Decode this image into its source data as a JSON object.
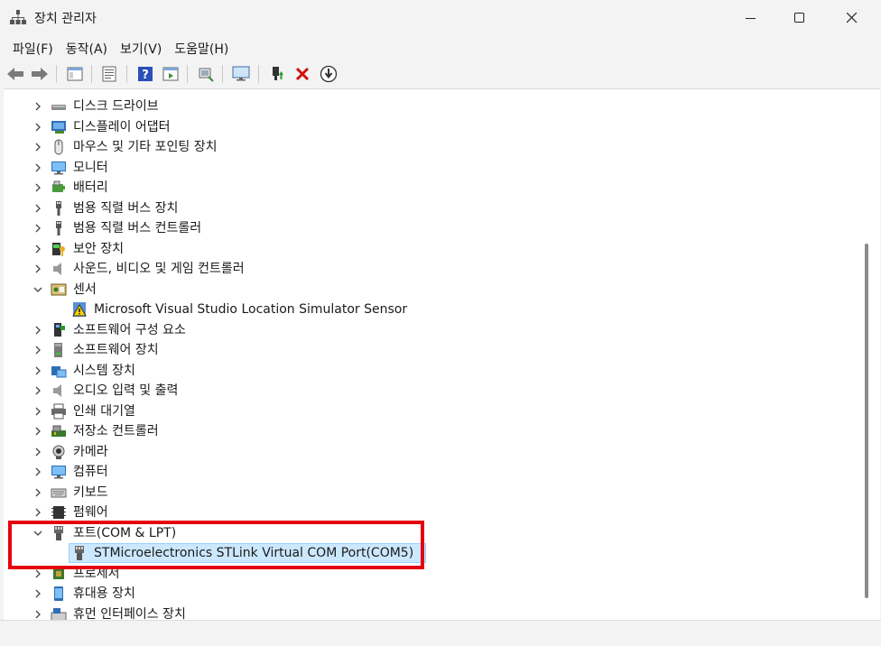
{
  "window": {
    "title": "장치 관리자"
  },
  "menu": [
    "파일(F)",
    "동작(A)",
    "보기(V)",
    "도움말(H)"
  ],
  "tree": [
    {
      "label": "디스크 드라이브",
      "icon": "disk-drive-icon",
      "expanded": false
    },
    {
      "label": "디스플레이 어댑터",
      "icon": "display-adapter-icon",
      "expanded": false
    },
    {
      "label": "마우스 및 기타 포인팅 장치",
      "icon": "mouse-icon",
      "expanded": false
    },
    {
      "label": "모니터",
      "icon": "monitor-icon",
      "expanded": false
    },
    {
      "label": "배터리",
      "icon": "battery-icon",
      "expanded": false
    },
    {
      "label": "범용 직렬 버스 장치",
      "icon": "usb-device-icon",
      "expanded": false
    },
    {
      "label": "범용 직렬 버스 컨트롤러",
      "icon": "usb-controller-icon",
      "expanded": false
    },
    {
      "label": "보안 장치",
      "icon": "security-device-icon",
      "expanded": false
    },
    {
      "label": "사운드, 비디오 및 게임 컨트롤러",
      "icon": "speaker-icon",
      "expanded": false
    },
    {
      "label": "센서",
      "icon": "sensor-icon",
      "expanded": true
    },
    {
      "label": "Microsoft Visual Studio Location Simulator Sensor",
      "icon": "warning-sensor-icon",
      "child": true
    },
    {
      "label": "소프트웨어 구성 요소",
      "icon": "software-component-icon",
      "expanded": false
    },
    {
      "label": "소프트웨어 장치",
      "icon": "software-device-icon",
      "expanded": false
    },
    {
      "label": "시스템 장치",
      "icon": "system-device-icon",
      "expanded": false
    },
    {
      "label": "오디오 입력 및 출력",
      "icon": "audio-icon",
      "expanded": false
    },
    {
      "label": "인쇄 대기열",
      "icon": "printer-icon",
      "expanded": false
    },
    {
      "label": "저장소 컨트롤러",
      "icon": "storage-controller-icon",
      "expanded": false
    },
    {
      "label": "카메라",
      "icon": "camera-icon",
      "expanded": false
    },
    {
      "label": "컴퓨터",
      "icon": "computer-icon",
      "expanded": false
    },
    {
      "label": "키보드",
      "icon": "keyboard-icon",
      "expanded": false
    },
    {
      "label": "펌웨어",
      "icon": "firmware-icon",
      "expanded": false
    },
    {
      "label": "포트(COM & LPT)",
      "icon": "port-icon",
      "expanded": true
    },
    {
      "label": "STMicroelectronics STLink Virtual COM Port(COM5)",
      "icon": "port-icon",
      "child": true,
      "selected": true
    },
    {
      "label": "프로세서",
      "icon": "processor-icon",
      "expanded": false
    },
    {
      "label": "휴대용 장치",
      "icon": "portable-device-icon",
      "expanded": false
    },
    {
      "label": "휴먼 인터페이스 장치",
      "icon": "hid-icon",
      "expanded": false
    }
  ],
  "colors": {
    "highlight": "#e4000f",
    "selection": "#cce8ff"
  }
}
